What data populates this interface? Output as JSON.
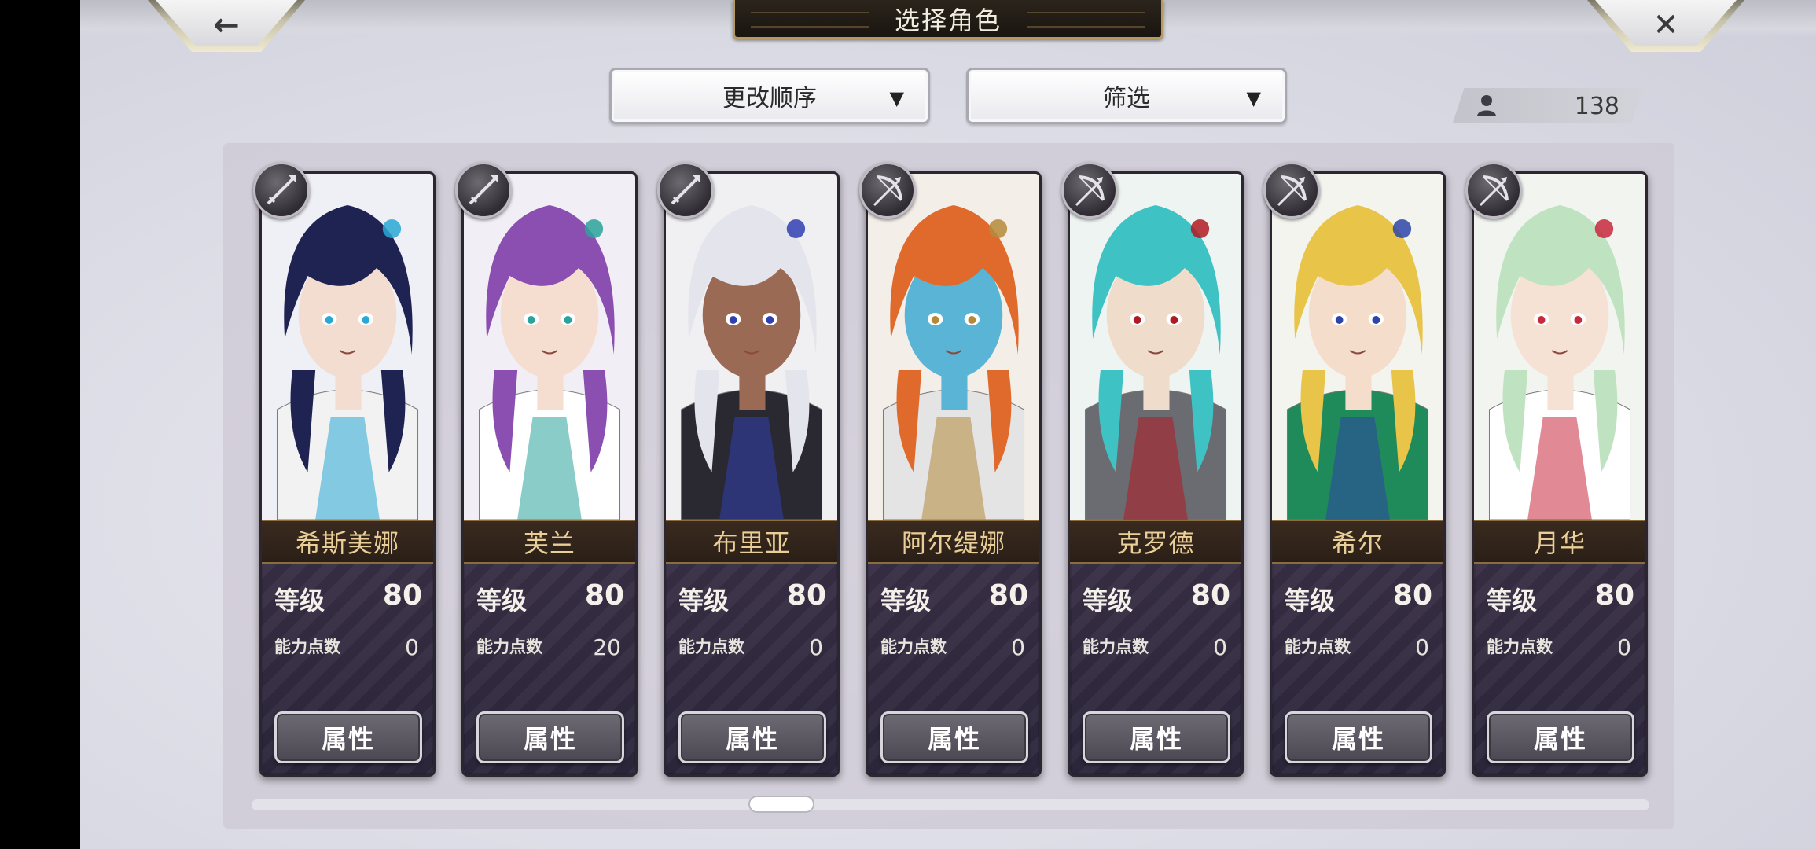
{
  "header": {
    "title": "选择角色",
    "back_icon": "←",
    "close_icon": "✕"
  },
  "controls": {
    "sort_label": "更改顺序",
    "filter_label": "筛选",
    "dropdown_arrow": "▼"
  },
  "roster": {
    "count": "138"
  },
  "card_labels": {
    "level": "等级",
    "ability_points": "能力点数",
    "attributes_button": "属性"
  },
  "characters": [
    {
      "name": "希斯美娜",
      "level": "80",
      "ability_points": "0",
      "class_icon": "spear-icon",
      "hair": "#1f2352",
      "skin": "#f3ddd0",
      "bg": "#eef0f6",
      "outfit": "#f2f2f2",
      "accent": "#29a8d6"
    },
    {
      "name": "芙兰",
      "level": "80",
      "ability_points": "20",
      "class_icon": "spear-icon",
      "hair": "#8a4fb0",
      "skin": "#f5ddd0",
      "bg": "#f2eef6",
      "outfit": "#ffffff",
      "accent": "#2aa39a"
    },
    {
      "name": "布里亚",
      "level": "80",
      "ability_points": "0",
      "class_icon": "spear-icon",
      "hair": "#e4e4ec",
      "skin": "#9a6a55",
      "bg": "#f0f0f3",
      "outfit": "#2a2830",
      "accent": "#3040b0"
    },
    {
      "name": "阿尔缇娜",
      "level": "80",
      "ability_points": "0",
      "class_icon": "bow-icon",
      "hair": "#e06a2c",
      "skin": "#5ab4d6",
      "bg": "#f4eee8",
      "outfit": "#e4e4e4",
      "accent": "#b5893a"
    },
    {
      "name": "克罗德",
      "level": "80",
      "ability_points": "0",
      "class_icon": "bow-icon",
      "hair": "#3fc2c4",
      "skin": "#f0dccb",
      "bg": "#eef4f2",
      "outfit": "#6b6b72",
      "accent": "#b01a22"
    },
    {
      "name": "希尔",
      "level": "80",
      "ability_points": "0",
      "class_icon": "bow-icon",
      "hair": "#e8c448",
      "skin": "#f5ddcc",
      "bg": "#f3f4ee",
      "outfit": "#1f8a5a",
      "accent": "#2d45a8"
    },
    {
      "name": "月华",
      "level": "80",
      "ability_points": "0",
      "class_icon": "bow-icon",
      "hair": "#bfe2c0",
      "skin": "#f6e2d4",
      "bg": "#f1f4ef",
      "outfit": "#ffffff",
      "accent": "#c8283c"
    }
  ]
}
